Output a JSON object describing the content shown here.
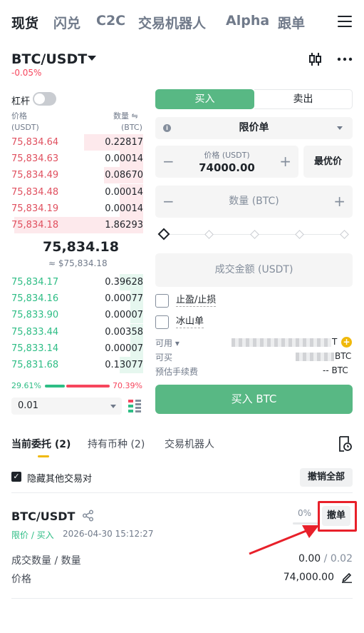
{
  "top_tabs": [
    "现货",
    "闪兑",
    "C2C",
    "交易机器人",
    "Alpha",
    "跟单"
  ],
  "pair": {
    "name": "BTC/USDT",
    "change": "-0.05%"
  },
  "order_book": {
    "leverage_label": "杠杆",
    "price_header": "价格",
    "price_unit": "(USDT)",
    "qty_header": "数量 ⇋",
    "qty_unit": "(BTC)",
    "asks": [
      {
        "price": "75,834.64",
        "qty": "0.22817",
        "depth": 0.45
      },
      {
        "price": "75,834.63",
        "qty": "0.00014",
        "depth": 0.18
      },
      {
        "price": "75,834.49",
        "qty": "0.08670",
        "depth": 0.3
      },
      {
        "price": "75,834.48",
        "qty": "0.00014",
        "depth": 0.18
      },
      {
        "price": "75,834.19",
        "qty": "0.00014",
        "depth": 0.18
      },
      {
        "price": "75,834.18",
        "qty": "1.86293",
        "depth": 0.98
      }
    ],
    "mid_price": "75,834.18",
    "mid_price_usd": "≈ $75,834.18",
    "bids": [
      {
        "price": "75,834.17",
        "qty": "0.39628",
        "depth": 0.18
      },
      {
        "price": "75,834.16",
        "qty": "0.00077",
        "depth": 0.1
      },
      {
        "price": "75,833.90",
        "qty": "0.00007",
        "depth": 0.1
      },
      {
        "price": "75,833.44",
        "qty": "0.00358",
        "depth": 0.1
      },
      {
        "price": "75,833.14",
        "qty": "0.00007",
        "depth": 0.1
      },
      {
        "price": "75,831.68",
        "qty": "0.13077",
        "depth": 0.18
      }
    ],
    "buy_ratio": "29.61%",
    "sell_ratio": "70.39%",
    "depth_step": "0.01"
  },
  "trade": {
    "buy_tab": "买入",
    "sell_tab": "卖出",
    "order_type": "限价单",
    "price_label": "价格 (USDT)",
    "price_value": "74000.00",
    "best_price": "最优价",
    "qty_placeholder": "数量 (BTC)",
    "amount_placeholder": "成交金额 (USDT)",
    "tp_sl": "止盈/止损",
    "iceberg": "冰山单",
    "available_label": "可用",
    "available_unit": "T",
    "can_buy_label": "可买",
    "can_buy_unit": "BTC",
    "fee_label": "预估手续费",
    "fee_value": "-- BTC",
    "buy_button": "买入 BTC"
  },
  "bottom_tabs": [
    "当前委托 (2)",
    "持有币种 (2)",
    "交易机器人"
  ],
  "orders": {
    "hide_other_pairs": "隐藏其他交易对",
    "cancel_all": "撤销全部",
    "order": {
      "pair": "BTC/USDT",
      "side": "限价 / 买入",
      "time": "2026-04-30 15:12:27",
      "progress": "0%",
      "cancel": "撤单",
      "filled_label": "成交数量 / 数量",
      "filled_value": "0.00",
      "total_qty": "/ 0.02",
      "price_label": "价格",
      "price_value": "74,000.00"
    }
  },
  "colors": {
    "buy": "#58b884",
    "sell": "#f6465d",
    "accent": "#f0b90b",
    "highlight": "#e8202a"
  }
}
